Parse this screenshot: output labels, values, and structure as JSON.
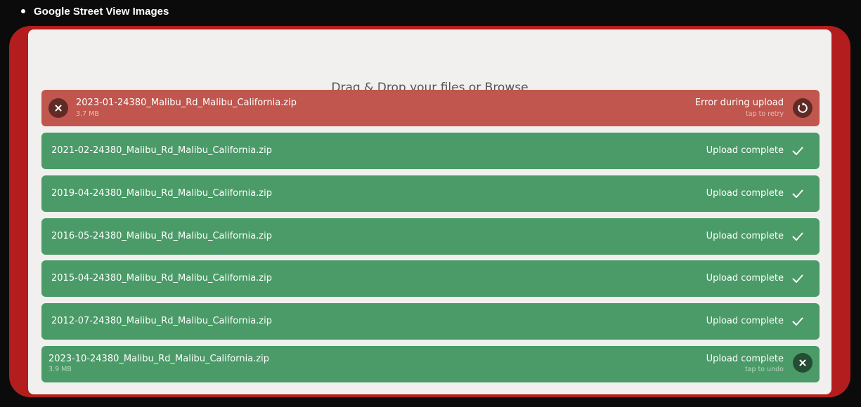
{
  "heading": {
    "bullet_text": "Google Street View Images"
  },
  "uploader": {
    "drop_text": "Drag & Drop your files or ",
    "browse_label": "Browse",
    "files": [
      {
        "name": "2023-01-24380_Malibu_Rd_Malibu_California.zip",
        "size": "3.7 MB",
        "status": "Error during upload",
        "substatus": "tap to retry",
        "state": "error"
      },
      {
        "name": "2021-02-24380_Malibu_Rd_Malibu_California.zip",
        "status": "Upload complete",
        "state": "complete"
      },
      {
        "name": "2019-04-24380_Malibu_Rd_Malibu_California.zip",
        "status": "Upload complete",
        "state": "complete"
      },
      {
        "name": "2016-05-24380_Malibu_Rd_Malibu_California.zip",
        "status": "Upload complete",
        "state": "complete"
      },
      {
        "name": "2015-04-24380_Malibu_Rd_Malibu_California.zip",
        "status": "Upload complete",
        "state": "complete"
      },
      {
        "name": "2012-07-24380_Malibu_Rd_Malibu_California.zip",
        "status": "Upload complete",
        "state": "complete"
      },
      {
        "name": "2023-10-24380_Malibu_Rd_Malibu_California.zip",
        "size": "3.9 MB",
        "status": "Upload complete",
        "substatus": "tap to undo",
        "state": "complete"
      }
    ]
  },
  "colors": {
    "page_background": "#0b0b0b",
    "frame_red": "#b41d1d",
    "dropzone_background": "#f1f0ef",
    "error_row": "#c0564d",
    "success_row": "#4a9b67"
  },
  "icons": {
    "remove": "close-icon",
    "retry": "retry-icon",
    "complete": "check-icon",
    "undo": "close-icon"
  }
}
